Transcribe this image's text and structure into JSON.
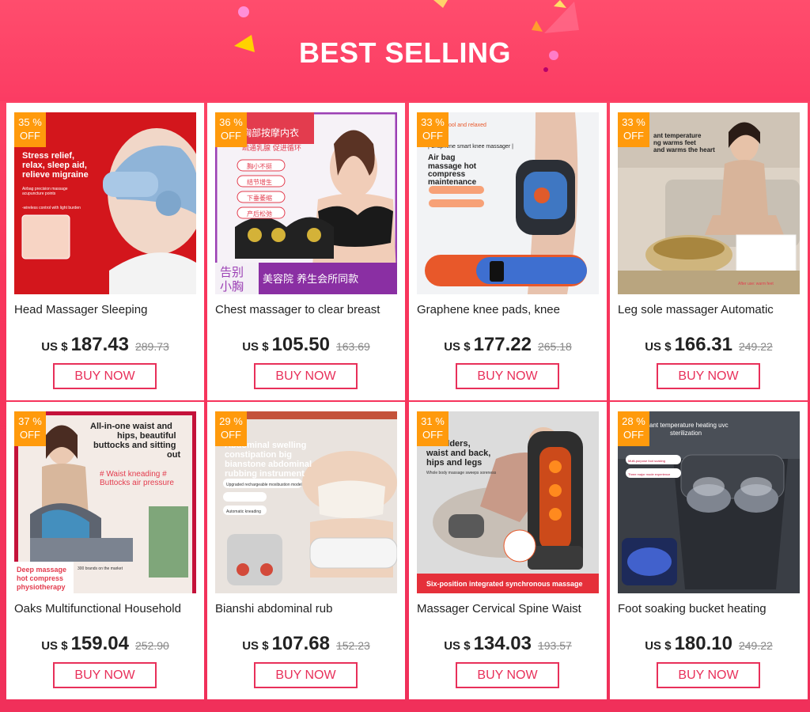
{
  "header": {
    "title": "BEST SELLING"
  },
  "colors": {
    "accent": "#e8305a",
    "badge": "#ff9a0c",
    "background": "#f8355c"
  },
  "products": [
    {
      "badge_pct": "35 %",
      "badge_off": "OFF",
      "name": "Head Massager Sleeping",
      "currency": "US $",
      "price": "187.43",
      "old_price": "289.73",
      "buy_label": "BUY NOW",
      "image_text": [
        "Stress relief,",
        "relax, sleep aid,",
        "relieve migraine",
        "Airbag precision massage",
        "acupuncture points",
        "-wireless control with light burden"
      ]
    },
    {
      "badge_pct": "36 %",
      "badge_off": "OFF",
      "name": "Chest massager to clear breast",
      "currency": "US $",
      "price": "105.50",
      "old_price": "163.69",
      "buy_label": "BUY NOW",
      "image_text": [
        "胸部按摩内衣",
        "疏通乳腺 促进循环",
        "胸小不挺",
        "结节增生",
        "下垂萎缩",
        "产后松弛",
        "告别",
        "小胸",
        "美容院 养生会所同款"
      ]
    },
    {
      "badge_pct": "33 %",
      "badge_off": "OFF",
      "name": "Graphene knee pads, knee",
      "currency": "US $",
      "price": "177.22",
      "old_price": "265.18",
      "buy_label": "BUY NOW",
      "image_text": [
        "ool and relaxed",
        "| Graphene smart knee massager |",
        "Air bag",
        "massage hot",
        "compress",
        "maintenance"
      ]
    },
    {
      "badge_pct": "33 %",
      "badge_off": "OFF",
      "name": "Leg sole massager Automatic",
      "currency": "US $",
      "price": "166.31",
      "old_price": "249.22",
      "buy_label": "BUY NOW",
      "image_text": [
        "ant temperature",
        "ng warms feet",
        "and warms the heart",
        "After use: warm feet"
      ]
    },
    {
      "badge_pct": "37 %",
      "badge_off": "OFF",
      "name": "Oaks Multifunctional Household",
      "currency": "US $",
      "price": "159.04",
      "old_price": "252.90",
      "buy_label": "BUY NOW",
      "image_text": [
        "All-in-one waist and",
        "hips, beautiful",
        "buttocks and sitting",
        "out",
        "# Waist kneading #",
        "Buttocks air pressure",
        "Deep massage",
        "hot compress",
        "physiotherapy",
        "300 brands on the market"
      ]
    },
    {
      "badge_pct": "29 %",
      "badge_off": "OFF",
      "name": "Bianshi abdominal rub",
      "currency": "US $",
      "price": "107.68",
      "old_price": "152.23",
      "buy_label": "BUY NOW",
      "image_text": [
        "Abdominal swelling",
        "constipation big",
        "bianstone abdominal",
        "rubbing instrument",
        "Upgraded rechargeable moxibustion model",
        "Automatic kneading"
      ]
    },
    {
      "badge_pct": "31 %",
      "badge_off": "OFF",
      "name": "Massager Cervical Spine Waist",
      "currency": "US $",
      "price": "134.03",
      "old_price": "193.57",
      "buy_label": "BUY NOW",
      "image_text": [
        "shoulders,",
        "waist and back,",
        "hips and legs",
        "Whole body massage sweeps soreness",
        "Six-position integrated synchronous massage"
      ]
    },
    {
      "badge_pct": "28 %",
      "badge_off": "OFF",
      "name": "Foot soaking bucket heating",
      "currency": "US $",
      "price": "180.10",
      "old_price": "249.22",
      "buy_label": "BUY NOW",
      "image_text": [
        "ant temperature heating uvc",
        "sterilization",
        "Multi-purpose foot soaking",
        "Three major mode experience"
      ]
    }
  ]
}
